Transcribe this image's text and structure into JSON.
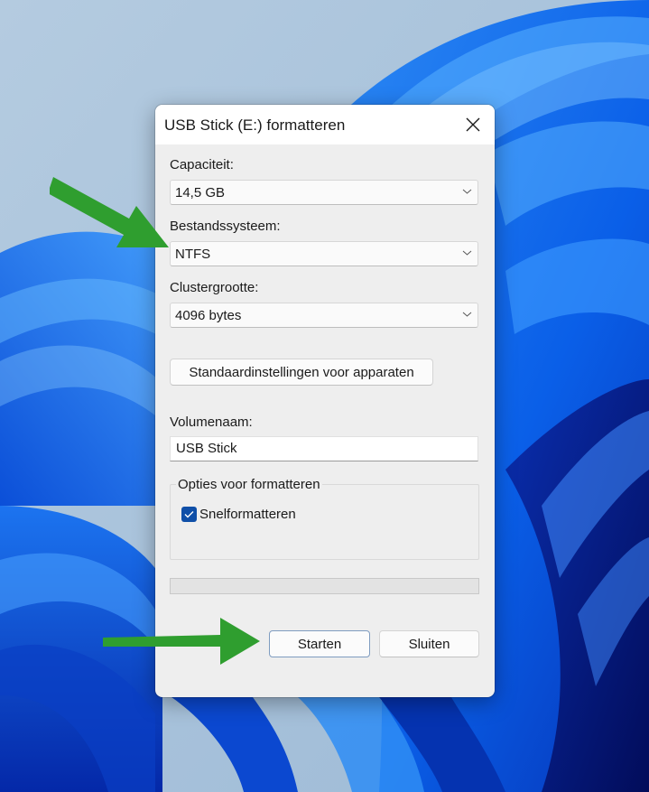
{
  "dialog": {
    "title": "USB Stick (E:) formatteren",
    "close_icon": "close-icon"
  },
  "fields": {
    "capacity": {
      "label": "Capaciteit:",
      "value": "14,5 GB"
    },
    "filesystem": {
      "label": "Bestandssysteem:",
      "value": "NTFS"
    },
    "cluster_size": {
      "label": "Clustergrootte:",
      "value": "4096 bytes"
    }
  },
  "restore_defaults_button": "Standaardinstellingen voor apparaten",
  "volume_label": {
    "label": "Volumenaam:",
    "value": "USB Stick"
  },
  "format_options": {
    "legend": "Opties voor formatteren",
    "quick_format": {
      "label": "Snelformatteren",
      "checked": true
    }
  },
  "progress": {
    "value": 0
  },
  "buttons": {
    "start": "Starten",
    "close": "Sluiten"
  },
  "annotations": {
    "arrow_color": "#2f9e2f",
    "arrows": [
      {
        "points_to": "filesystem-combobox",
        "direction": "down-right"
      },
      {
        "points_to": "start-button",
        "direction": "right"
      }
    ]
  },
  "colors": {
    "accent": "#0f4fa8",
    "dialog_bg": "#eeeeee",
    "titlebar_bg": "#ffffff"
  }
}
